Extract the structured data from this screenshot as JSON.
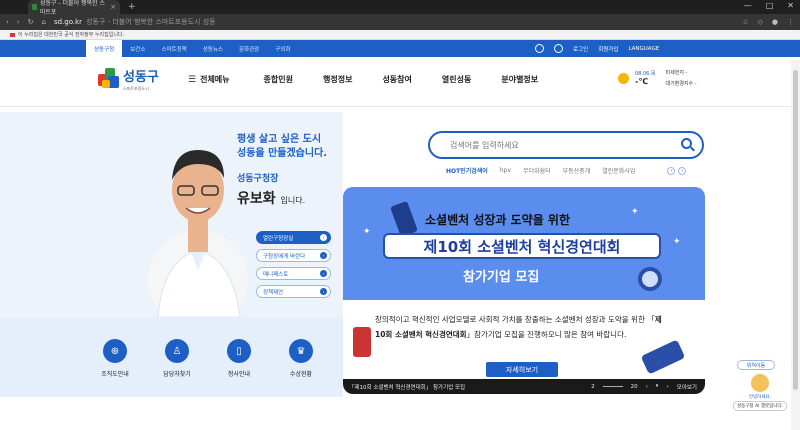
{
  "browser": {
    "tab_title": "성동구 - 더불어 행복한 스마트포",
    "new_tab": "+",
    "url_domain": "sd.go.kr",
    "url_title": "성동구 - 더불어 행복한 스마트포용도시 성동"
  },
  "gov_banner": "이 누리집은 대한민국 공식 전자정부 누리집입니다.",
  "util_nav": {
    "items": [
      "성동구청",
      "보건소",
      "스마트정책",
      "성동뉴스",
      "문화관광",
      "구의회"
    ],
    "login": "로그인",
    "join": "회원가입",
    "language": "LANGUAGE"
  },
  "logo": {
    "name": "성동구",
    "sub": "스마트포용도시"
  },
  "gnb": {
    "all_menu": "전체메뉴",
    "items": [
      "종합민원",
      "행정정보",
      "성동참여",
      "열린성동",
      "분야별정보"
    ]
  },
  "weather": {
    "date": "08.06.목",
    "temp": "-℃",
    "dust1": "미세먼지 -",
    "dust2": "대기환경지수 -"
  },
  "mayor": {
    "slogan1": "평생 살고 싶은 도시",
    "slogan2": "성동을 만들겠습니다.",
    "role": "성동구청장",
    "name": "유보화",
    "suffix": "입니다.",
    "buttons": [
      "열린구청장실",
      "구청장에게 바란다",
      "매니페스토",
      "정책제안"
    ]
  },
  "quick_links": [
    "조직도안내",
    "담당자찾기",
    "청사안내",
    "수상현황"
  ],
  "search": {
    "placeholder": "검색어를 입력하세요",
    "hot_title": "HOT인기검색어",
    "hot_items": [
      "hpv",
      "무더위쉼터",
      "부동산중개",
      "열린문화사업"
    ]
  },
  "banner": {
    "title1": "소셜벤처 성장과 도약을 위한",
    "title2": "제10회 소셜벤처 혁신경연대회",
    "title3": "참가기업 모집",
    "body_pre": "창의적이고 혁신적인 사업모델로 사회적 가치를 창출하는 소셜벤처 성장과 도약을 위한 「",
    "body_bold": "제10회 소셜벤처 혁신경연대회",
    "body_post": "」참가기업 모집을 진행하오니 많은 참여 바랍니다.",
    "button": "자세히보기",
    "caption": "「제10회 소셜벤처 혁신경연대회」 참가기업 모집",
    "page_current": "2",
    "page_total": "20",
    "view_all": "모아보기"
  },
  "floating": {
    "top_button": "위쳐이동",
    "ai_greet": "안녕하세요.",
    "ai_name": "성동구청 AI 챗봇입니다."
  },
  "colors": {
    "brand_blue": "#1d5fc5",
    "banner_blue": "#5a8dee"
  }
}
